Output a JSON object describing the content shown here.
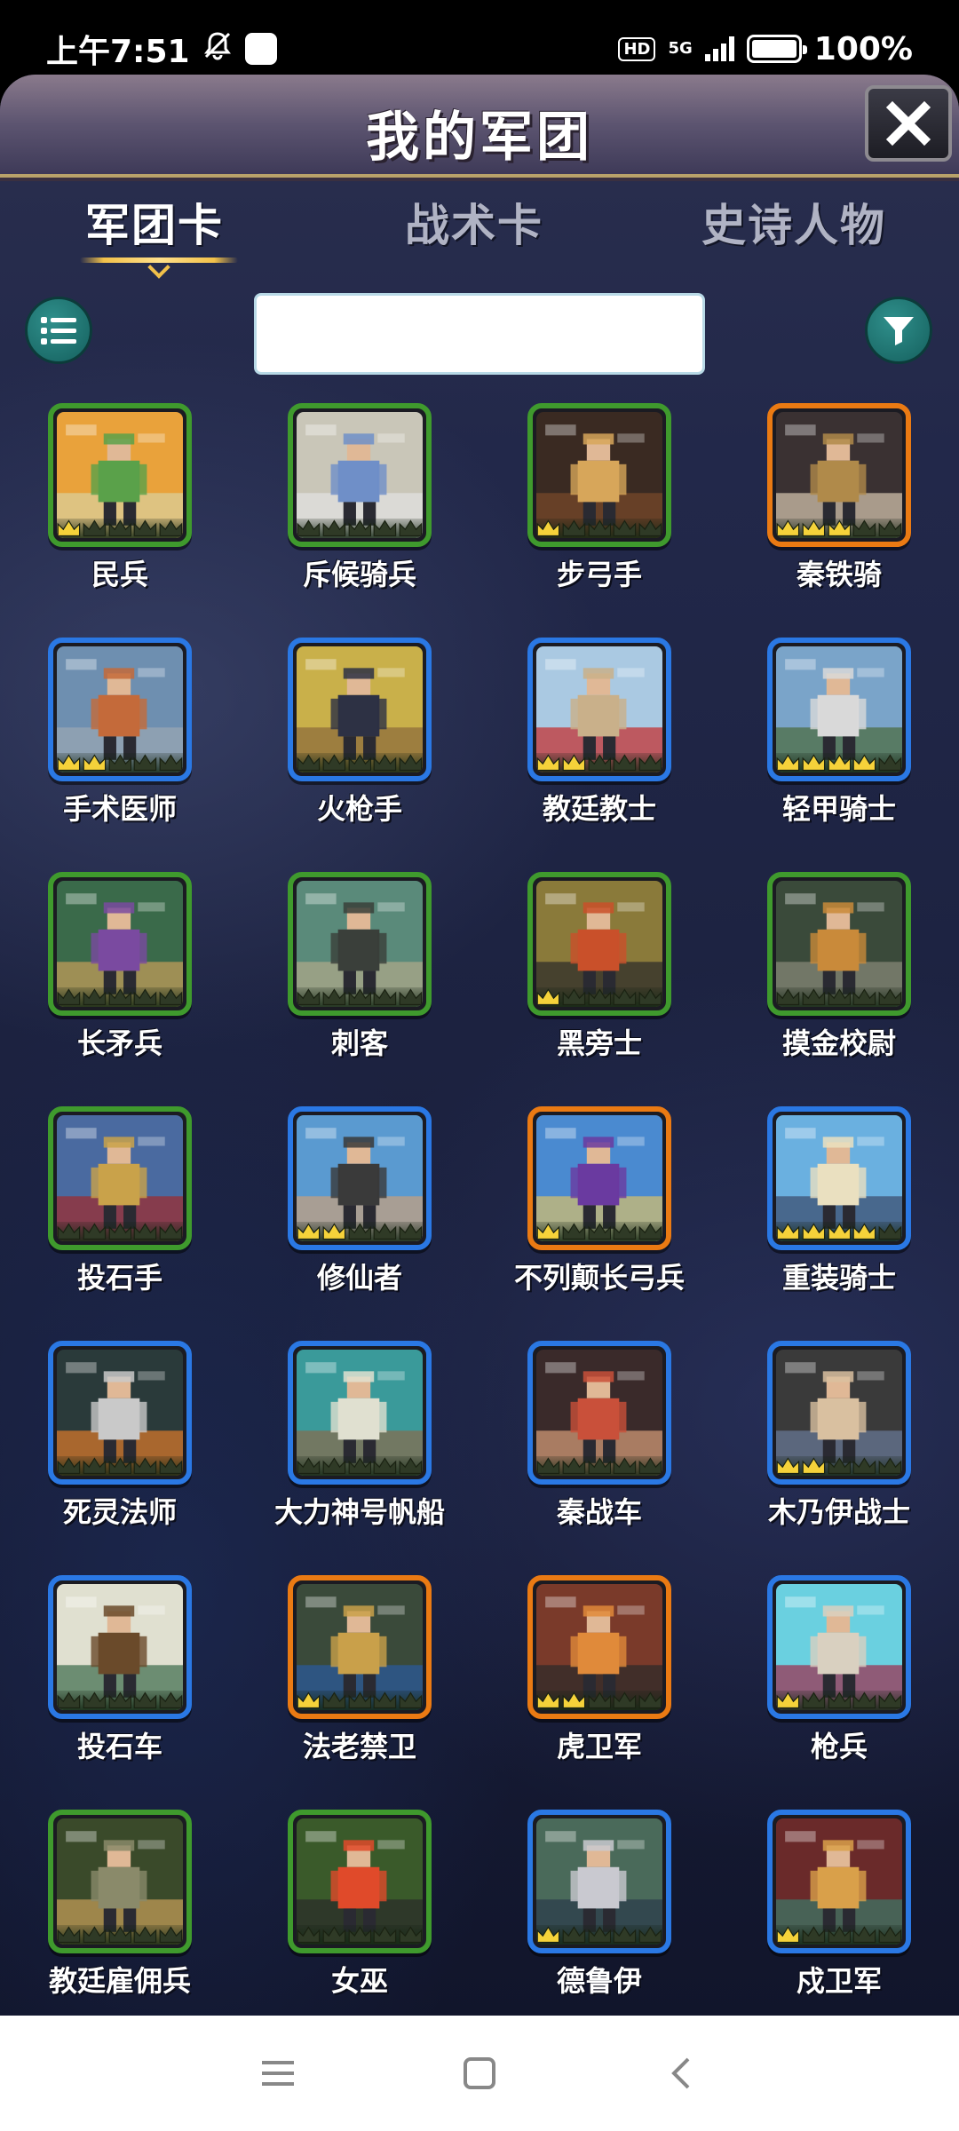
{
  "status_bar": {
    "time": "上午7:51",
    "network": "5G",
    "battery_text": "100%",
    "hd_label": "HD"
  },
  "header": {
    "title": "我的军团"
  },
  "tabs": [
    {
      "label": "军团卡",
      "active": true
    },
    {
      "label": "战术卡",
      "active": false
    },
    {
      "label": "史诗人物",
      "active": false
    }
  ],
  "search": {
    "value": "",
    "placeholder": ""
  },
  "colors": {
    "rarity_green": "#3f9a2d",
    "rarity_blue": "#2a78e4",
    "rarity_orange": "#ea7a13",
    "button_teal": "#1f7a77",
    "title_gold": "#f2c14a"
  },
  "cards": [
    {
      "name": "民兵",
      "rarity": "green",
      "crowns": 1
    },
    {
      "name": "斥候骑兵",
      "rarity": "green",
      "crowns": 0
    },
    {
      "name": "步弓手",
      "rarity": "green",
      "crowns": 1
    },
    {
      "name": "秦铁骑",
      "rarity": "orange",
      "crowns": 3
    },
    {
      "name": "手术医师",
      "rarity": "blue",
      "crowns": 2
    },
    {
      "name": "火枪手",
      "rarity": "blue",
      "crowns": 0
    },
    {
      "name": "教廷教士",
      "rarity": "blue",
      "crowns": 2
    },
    {
      "name": "轻甲骑士",
      "rarity": "blue",
      "crowns": 4
    },
    {
      "name": "长矛兵",
      "rarity": "green",
      "crowns": 0
    },
    {
      "name": "刺客",
      "rarity": "green",
      "crowns": 0
    },
    {
      "name": "黑旁士",
      "rarity": "green",
      "crowns": 1
    },
    {
      "name": "摸金校尉",
      "rarity": "green",
      "crowns": 0
    },
    {
      "name": "投石手",
      "rarity": "green",
      "crowns": 0
    },
    {
      "name": "修仙者",
      "rarity": "blue",
      "crowns": 2
    },
    {
      "name": "不列颠长弓兵",
      "rarity": "orange",
      "crowns": 1
    },
    {
      "name": "重装骑士",
      "rarity": "blue",
      "crowns": 4
    },
    {
      "name": "死灵法师",
      "rarity": "blue",
      "crowns": 0
    },
    {
      "name": "大力神号帆船",
      "rarity": "blue",
      "crowns": 0
    },
    {
      "name": "秦战车",
      "rarity": "blue",
      "crowns": 0
    },
    {
      "name": "木乃伊战士",
      "rarity": "blue",
      "crowns": 2
    },
    {
      "name": "投石车",
      "rarity": "blue",
      "crowns": 0
    },
    {
      "name": "法老禁卫",
      "rarity": "orange",
      "crowns": 1
    },
    {
      "name": "虎卫军",
      "rarity": "orange",
      "crowns": 2
    },
    {
      "name": "枪兵",
      "rarity": "blue",
      "crowns": 1
    },
    {
      "name": "教廷雇佣兵",
      "rarity": "green",
      "crowns": 0
    },
    {
      "name": "女巫",
      "rarity": "green",
      "crowns": 0
    },
    {
      "name": "德鲁伊",
      "rarity": "blue",
      "crowns": 1
    },
    {
      "name": "戍卫军",
      "rarity": "blue",
      "crowns": 1
    }
  ],
  "icons": {
    "list": "list-icon",
    "filter": "filter-icon",
    "close": "close-icon",
    "nav_menu": "menu-icon",
    "nav_home": "home-icon",
    "nav_back": "back-icon"
  }
}
